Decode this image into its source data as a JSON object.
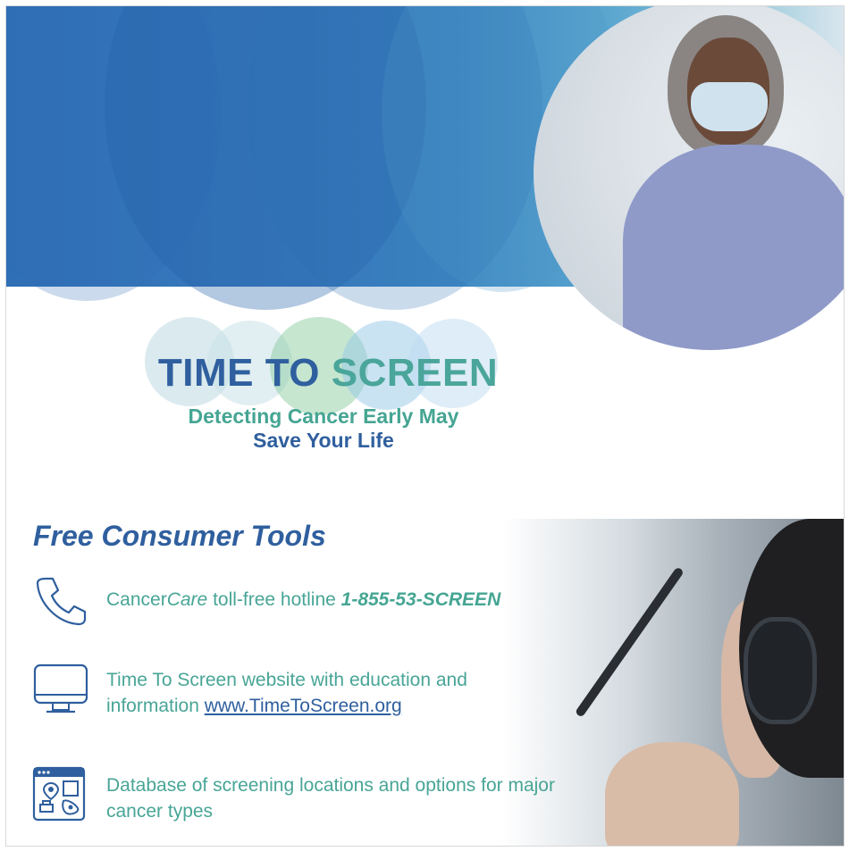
{
  "logo": {
    "word1": "TIME TO",
    "word2": "SCREEN",
    "tagline_line1": "Detecting Cancer Early May",
    "tagline_line2": "Save Your Life"
  },
  "tools": {
    "title": "Free Consumer Tools",
    "hotline": {
      "icon": "phone-icon",
      "prefix": "Cancer",
      "brand_italic": "Care",
      "text": " toll-free hotline ",
      "number": "1-855-53-SCREEN"
    },
    "website": {
      "icon": "monitor-icon",
      "text_line1": "Time To Screen website with education and",
      "text_line2_prefix": "information ",
      "url": "www.TimeToScreen.org"
    },
    "database": {
      "icon": "map-location-icon",
      "text": "Database of screening locations and options for major cancer types"
    }
  },
  "colors": {
    "brand_blue": "#2f5f9e",
    "brand_teal": "#48a596"
  }
}
